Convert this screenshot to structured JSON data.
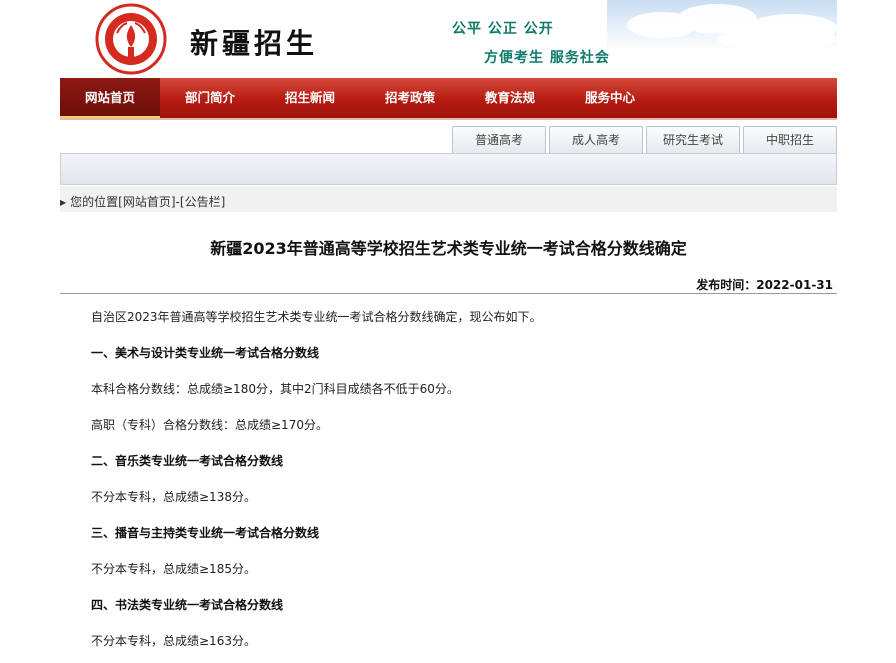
{
  "header": {
    "logo_text": "新疆招生",
    "site_name": "新疆招生",
    "slogan_line1": "公平  公正  公开",
    "slogan_line2": "方便考生   服务社会"
  },
  "nav": {
    "items": [
      {
        "label": "网站首页",
        "active": true
      },
      {
        "label": "部门简介"
      },
      {
        "label": "招生新闻"
      },
      {
        "label": "招考政策"
      },
      {
        "label": "教育法规"
      },
      {
        "label": "服务中心"
      }
    ]
  },
  "subtabs": [
    "普通高考",
    "成人高考",
    "研究生考试",
    "中职招生"
  ],
  "breadcrumb": {
    "prefix": "您的位置",
    "home": "[网站首页]",
    "separator": "-",
    "section": "[公告栏]"
  },
  "article": {
    "title": "新疆2023年普通高等学校招生艺术类专业统一考试合格分数线确定",
    "date_label": "发布时间：",
    "date": "2022-01-31",
    "paragraphs": [
      {
        "text": "自治区2023年普通高等学校招生艺术类专业统一考试合格分数线确定，现公布如下。",
        "bold": false
      },
      {
        "text": "一、美术与设计类专业统一考试合格分数线",
        "bold": true
      },
      {
        "text": "本科合格分数线：总成绩≥180分，其中2门科目成绩各不低于60分。",
        "bold": false
      },
      {
        "text": "高职（专科）合格分数线：总成绩≥170分。",
        "bold": false
      },
      {
        "text": "二、音乐类专业统一考试合格分数线",
        "bold": true
      },
      {
        "text": "不分本专科，总成绩≥138分。",
        "bold": false
      },
      {
        "text": "三、播音与主持类专业统一考试合格分数线",
        "bold": true
      },
      {
        "text": "不分本专科，总成绩≥185分。",
        "bold": false
      },
      {
        "text": "四、书法类专业统一考试合格分数线",
        "bold": true
      },
      {
        "text": "不分本专科，总成绩≥163分。",
        "bold": false
      }
    ]
  },
  "colors": {
    "nav_red": "#b51b12",
    "slogan_green": "#0f7a6a",
    "logo_red": "#d42a1f"
  }
}
